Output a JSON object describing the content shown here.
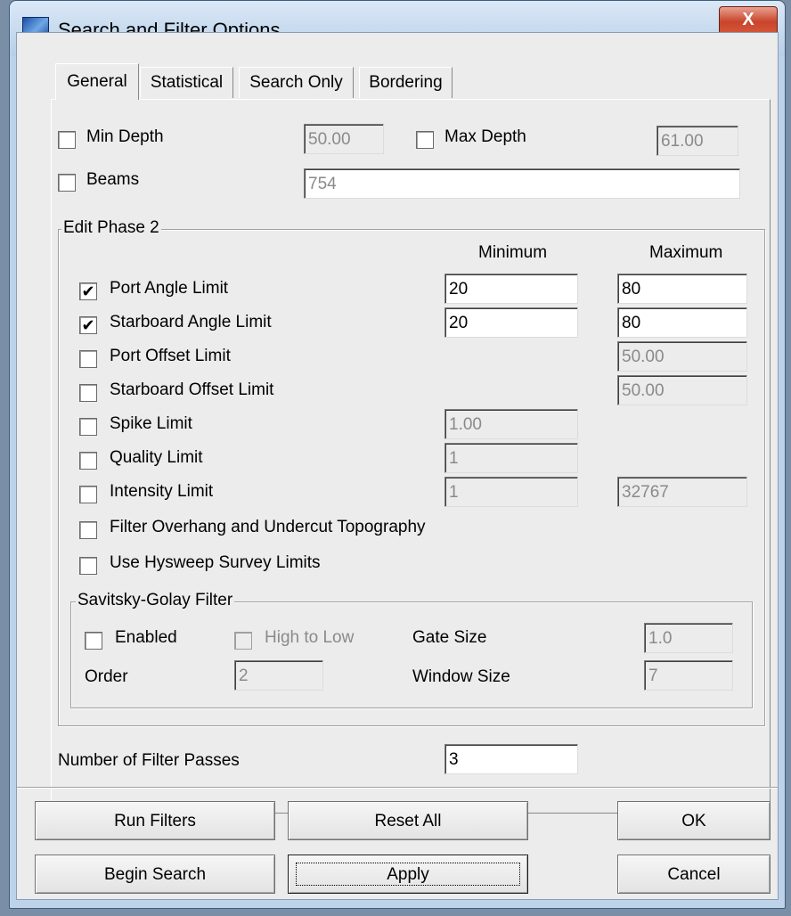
{
  "window": {
    "title": "Search and Filter Options",
    "close_label": "X"
  },
  "tabs": [
    "General",
    "Statistical",
    "Search Only",
    "Bordering"
  ],
  "general": {
    "min_depth": {
      "label": "Min Depth",
      "checked": false,
      "value": "50.00"
    },
    "max_depth": {
      "label": "Max Depth",
      "checked": false,
      "value": "61.00"
    },
    "beams": {
      "label": "Beams",
      "checked": false,
      "value": "754"
    }
  },
  "edit_phase": {
    "title": "Edit Phase 2",
    "col_min": "Minimum",
    "col_max": "Maximum",
    "rows": [
      {
        "label": "Port Angle Limit",
        "checked": true,
        "min": "20",
        "max": "80"
      },
      {
        "label": "Starboard Angle Limit",
        "checked": true,
        "min": "20",
        "max": "80"
      },
      {
        "label": "Port Offset Limit",
        "checked": false,
        "max": "50.00"
      },
      {
        "label": "Starboard Offset Limit",
        "checked": false,
        "max": "50.00"
      },
      {
        "label": "Spike Limit",
        "checked": false,
        "min": "1.00"
      },
      {
        "label": "Quality Limit",
        "checked": false,
        "min": "1"
      },
      {
        "label": "Intensity Limit",
        "checked": false,
        "min": "1",
        "max": "32767"
      }
    ],
    "filter_overhang": "Filter Overhang and Undercut Topography",
    "hysweep_limits": "Use Hysweep Survey Limits",
    "sg": {
      "title": "Savitsky-Golay Filter",
      "enabled": "Enabled",
      "high_to_low": "High to Low",
      "order_label": "Order",
      "order_value": "2",
      "gate_label": "Gate Size",
      "gate_value": "1.0",
      "window_label": "Window Size",
      "window_value": "7"
    }
  },
  "passes": {
    "label": "Number of Filter Passes",
    "value": "3"
  },
  "buttons": {
    "run_filters": "Run Filters",
    "reset_all": "Reset All",
    "ok": "OK",
    "begin_search": "Begin Search",
    "apply": "Apply",
    "cancel": "Cancel"
  },
  "check_mark": "✔"
}
